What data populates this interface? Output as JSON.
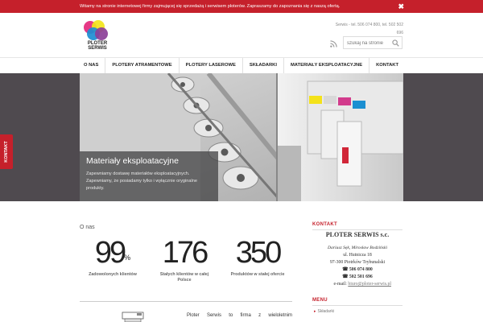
{
  "notice": {
    "text": "Witamy na stronie internetowej firmy zajmującej się sprzedażą i serwisem ploterów. Zapraszamy do zapoznania się z naszą ofertą.",
    "close": "✖"
  },
  "header": {
    "logo_line1": "PLOTER",
    "logo_line2": "SERWIS",
    "contact_text": "Serwis - tel. 506 074 800, tel. 502 502 696",
    "search_placeholder": "szukaj na stronie"
  },
  "nav": {
    "items": [
      "O NAS",
      "PLOTERY ATRAMENTOWE",
      "PLOTERY LASEROWE",
      "SKŁADARKI",
      "MATERIAŁY EKSPLOATACYJNE",
      "KONTAKT"
    ]
  },
  "hero": {
    "title": "Materiały eksploatacyjne",
    "text": "Zapewniamy dostawę materiałów eksploatacyjnych. Zapewniamy, że posiadamy tylko i wyłącznie oryginalne produkty."
  },
  "side_tab": "KONTAKT",
  "about": {
    "title": "O nas",
    "stats": [
      {
        "value": "99",
        "suffix": "%",
        "label": "Zadowolonych klientów"
      },
      {
        "value": "176",
        "suffix": "",
        "label": "Stałych klientów w całej Polsce"
      },
      {
        "value": "350",
        "suffix": "",
        "label": "Produktów w stałej ofercie"
      }
    ],
    "text_words": [
      "Ploter",
      "Serwis",
      "to",
      "firma",
      "z",
      "wieloletnim"
    ]
  },
  "sidebar": {
    "contact_heading": "KONTAKT",
    "company": "PLOTER SERWIS s.c.",
    "people": "Dariusz Sęk, Mirosław Bodziński",
    "street": "ul. Hutnicza 18",
    "city": "97-300 Piotrków Trybunalski",
    "phone1": "☎ 506 074 800",
    "phone2": "☎ 502 501 696",
    "email_label": "e-mail:",
    "email": "biuro@ploter-serwis.pl",
    "menu_heading": "MENU",
    "menu_items": [
      "Składarki"
    ]
  },
  "colors": {
    "accent": "#c5202b",
    "hero_bg": "#4f4a4f"
  }
}
